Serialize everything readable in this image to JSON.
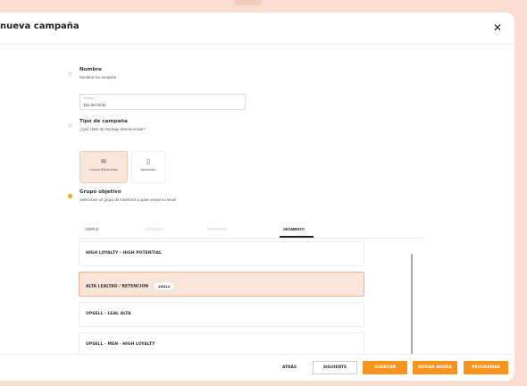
{
  "modal": {
    "title": "nueva campaña",
    "close_icon": "close-icon"
  },
  "steps": {
    "name": {
      "title": "Nombre",
      "subtitle": "Nombrar sui campaña",
      "field_label": "Nombre",
      "field_value": "Dia del Grito"
    },
    "type": {
      "title": "Tipo de campaña",
      "subtitle": "¿Qué clase de mensaje deseas enviar?",
      "options": [
        {
          "label": "Correo Electrónico",
          "icon": "email-icon",
          "selected": true
        },
        {
          "label": "Aplicación",
          "icon": "mobile-icon",
          "selected": false
        }
      ]
    },
    "audience": {
      "title": "Grupo objetivo",
      "subtitle": "Seleccione un grupo de miembros a quien enviar su email"
    }
  },
  "tabs": [
    "SIMPLE",
    "AVANZADO",
    "EXPERTAS",
    "SEGMENTO"
  ],
  "active_tab": "SEGMENTO",
  "segments": [
    {
      "label": "HIGH LOYALTY - HIGH POTENTIAL",
      "count": "",
      "selected": false
    },
    {
      "label": "ALTA LEALTAD / RETENCION",
      "count": "45814",
      "selected": true
    },
    {
      "label": "UPSELL - LEAL ALTA",
      "count": "",
      "selected": false
    },
    {
      "label": "UPSELL - MEN - HIGH LOYALTY",
      "count": "",
      "selected": false
    }
  ],
  "footer": {
    "back": "ATRÁS",
    "next": "SIGUIENTE",
    "save": "GUARDAR",
    "send_now": "ENVIAR AHORA",
    "schedule": "PROGRAMAR"
  },
  "colors": {
    "accent": "#f7941d",
    "selected_bg": "#fae5da",
    "page_bg": "#f8ddd0"
  }
}
